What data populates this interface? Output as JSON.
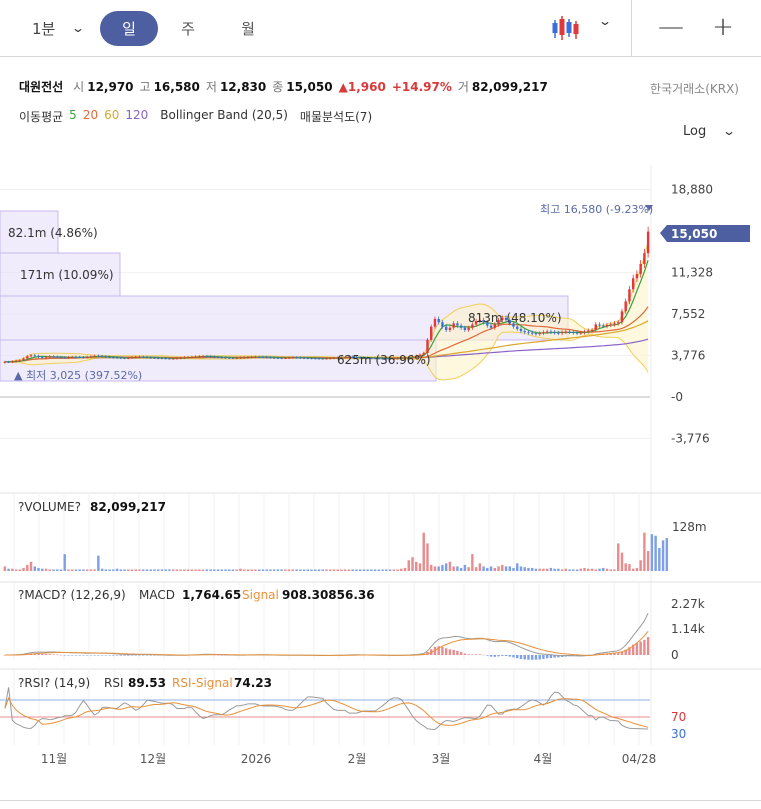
{
  "toolbar": {
    "interval": "1분",
    "tabs": [
      "일",
      "주",
      "월"
    ],
    "active_tab": 0
  },
  "stock": {
    "name": "대원전선",
    "open_label": "시",
    "open": "12,970",
    "high_label": "고",
    "high": "16,580",
    "low_label": "저",
    "low": "12,830",
    "close_label": "종",
    "close": "15,050",
    "change": "1,960",
    "change_pct": "+14.97%",
    "volume_label": "거",
    "volume": "82,099,217",
    "exchange": "한국거래소(KRX)"
  },
  "indicators": {
    "ma_label": "이동평균",
    "ma": [
      "5",
      "20",
      "60",
      "120"
    ],
    "bollinger": "Bollinger Band (20,5)",
    "volume_profile": "매물분석도(7)",
    "scale": "Log"
  },
  "colors": {
    "up": "#e0393b",
    "down": "#3b6fd8",
    "accent": "#4d5fa0",
    "ma5": "#3aa03a",
    "ma20": "#e06a3a",
    "ma60": "#d9a72a",
    "ma120": "#8a62c7",
    "bollinger": "#f0cf5a",
    "profile": "#e4dcf7"
  },
  "chart_data": {
    "type": "candlestick",
    "price_axis": {
      "ticks": [
        "18,880",
        "11,328",
        "7,552",
        "3,776",
        "-0",
        "-3,776"
      ],
      "current": "15,050"
    },
    "x_ticks": [
      "11월",
      "12월",
      "2026",
      "2월",
      "3월",
      "4월",
      "04/28"
    ],
    "annotations": {
      "high": "최고 16,580 (-9.23%)",
      "low": "최저 3,025 (397.52%)"
    },
    "volume_profile": [
      {
        "label": "82.1m (4.86%)"
      },
      {
        "label": "171m (10.09%)"
      },
      {
        "label": "813m (48.10%)"
      },
      {
        "label": "625m (36.96%)"
      }
    ],
    "close_series": [
      3200,
      3180,
      3250,
      3300,
      3350,
      3500,
      3700,
      3800,
      3750,
      3650,
      3600,
      3620,
      3700,
      3680,
      3640,
      3600,
      3580,
      3620,
      3650,
      3640,
      3620,
      3600,
      3660,
      3700,
      3750,
      3720,
      3680,
      3650,
      3620,
      3600,
      3580,
      3560,
      3540,
      3560,
      3600,
      3640,
      3660,
      3630,
      3600,
      3580,
      3560,
      3550,
      3540,
      3520,
      3500,
      3510,
      3540,
      3560,
      3600,
      3620,
      3650,
      3680,
      3700,
      3720,
      3690,
      3660,
      3640,
      3620,
      3600,
      3580,
      3560,
      3550,
      3560,
      3580,
      3600,
      3620,
      3640,
      3660,
      3650,
      3630,
      3610,
      3590,
      3570,
      3560,
      3550,
      3560,
      3580,
      3600,
      3590,
      3570,
      3550,
      3540,
      3530,
      3520,
      3510,
      3500,
      3520,
      3540,
      3560,
      3580,
      3600,
      3620,
      3640,
      3620,
      3600,
      3580,
      3560,
      3550,
      3540,
      3530,
      3520,
      3510,
      3500,
      3490,
      3500,
      3520,
      3550,
      3580,
      3620,
      3680,
      3750,
      3850,
      4000,
      5200,
      6400,
      7100,
      6800,
      6400,
      6100,
      6300,
      6700,
      6500,
      6300,
      6100,
      6300,
      6600,
      6900,
      7000,
      6800,
      6500,
      6300,
      6600,
      7000,
      7200,
      7000,
      6700,
      6400,
      6200,
      6000,
      5900,
      5850,
      5800,
      5750,
      5800,
      5900,
      5950,
      5900,
      5850,
      5800,
      5900,
      5950,
      5900,
      5850,
      5800,
      5850,
      5950,
      6050,
      6100,
      6600,
      6500,
      6450,
      6550,
      6600,
      6700,
      6800,
      7800,
      8700,
      9800,
      10800,
      11200,
      12100,
      13090,
      15050
    ],
    "volume_series": [
      6,
      3,
      3,
      2,
      2,
      4,
      8,
      12,
      6,
      4,
      3,
      3,
      2,
      2,
      2,
      2,
      22,
      2,
      2,
      2,
      2,
      2,
      2,
      2,
      2,
      20,
      3,
      2,
      2,
      2,
      3,
      2,
      2,
      2,
      2,
      2,
      2,
      2,
      2,
      2,
      2,
      2,
      2,
      2,
      2,
      2,
      2,
      2,
      2,
      2,
      2,
      2,
      2,
      2,
      2,
      2,
      2,
      2,
      2,
      2,
      2,
      2,
      2,
      3,
      2,
      2,
      2,
      2,
      2,
      2,
      2,
      2,
      2,
      2,
      2,
      2,
      2,
      2,
      2,
      2,
      2,
      2,
      2,
      2,
      2,
      2,
      2,
      2,
      2,
      2,
      2,
      2,
      2,
      2,
      2,
      2,
      2,
      2,
      2,
      2,
      2,
      2,
      2,
      2,
      2,
      2,
      3,
      4,
      14,
      18,
      12,
      10,
      50,
      36,
      8,
      6,
      6,
      8,
      10,
      12,
      6,
      6,
      4,
      8,
      5,
      22,
      5,
      10,
      6,
      4,
      6,
      4,
      6,
      8,
      6,
      6,
      4,
      10,
      6,
      5,
      4,
      4,
      3,
      3,
      3,
      3,
      4,
      3,
      3,
      2,
      3,
      2,
      2,
      2,
      3,
      4,
      3,
      3,
      2,
      3,
      4,
      3,
      2,
      2,
      36,
      24,
      10,
      9,
      3,
      4,
      14,
      50,
      26,
      48,
      46,
      30,
      40,
      43
    ],
    "macd": {
      "label": "MACD",
      "params": "(12,26,9)",
      "value": "1,764.65",
      "signal_label": "Signal",
      "signal": "908.30856.36",
      "ticks": [
        "2.27k",
        "1.14k",
        "0"
      ]
    },
    "rsi": {
      "label": "RSI",
      "params": "(14,9)",
      "value": "89.53",
      "signal_label": "RSI-Signal",
      "signal": "74.23",
      "levels": [
        "70",
        "30"
      ]
    },
    "volume_label": "VOLUME",
    "volume_value": "82,099,217",
    "volume_tick": "128m"
  }
}
